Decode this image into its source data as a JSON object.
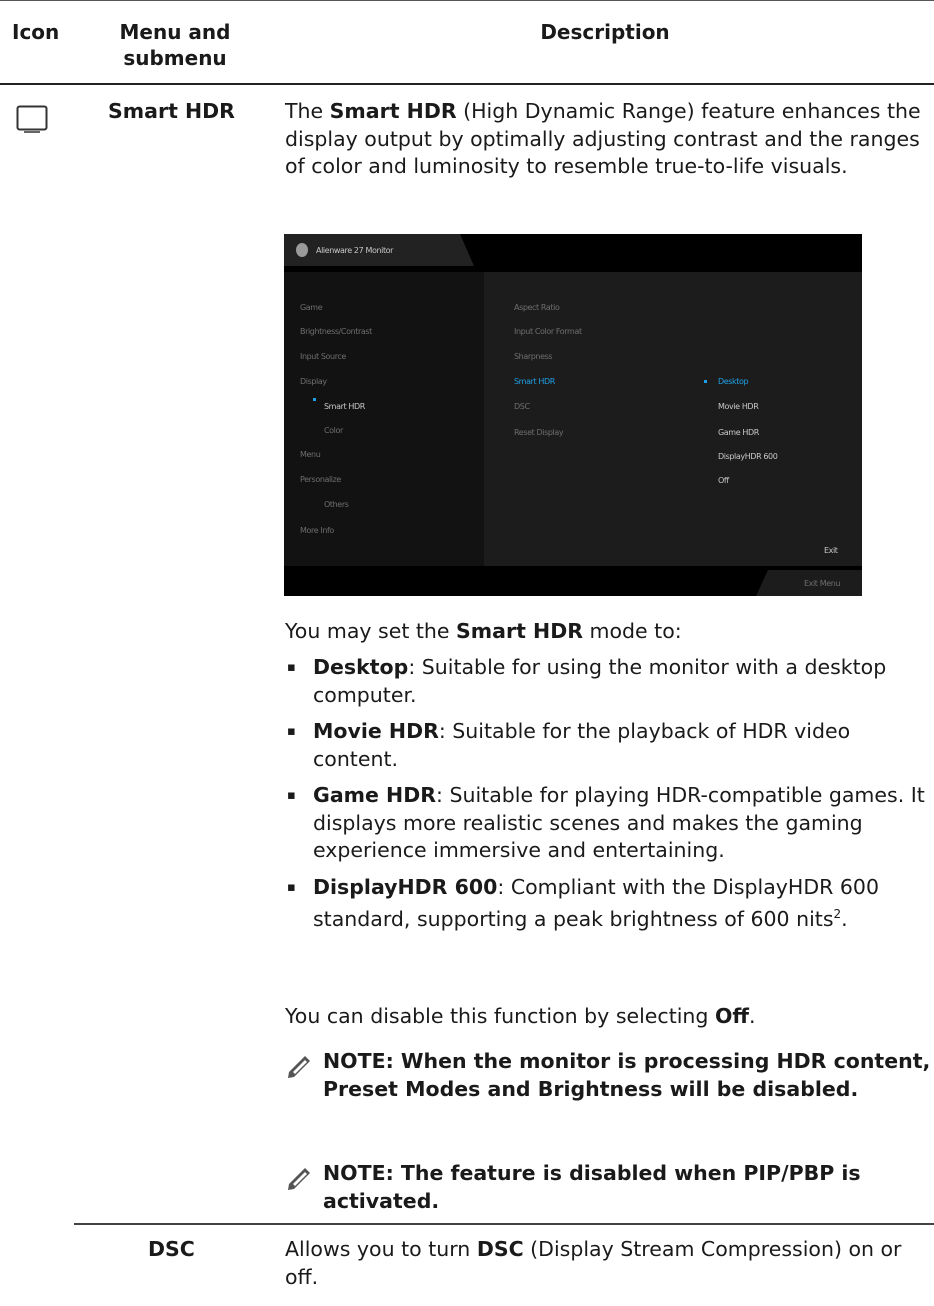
{
  "table_header": {
    "icon": "Icon",
    "menu": "Menu and submenu",
    "description": "Description"
  },
  "rows": [
    {
      "icon_name": "monitor-icon",
      "menu": "Smart HDR",
      "intro": {
        "pre": "The ",
        "bold": "Smart HDR",
        "post": " (High Dynamic Range) feature enhances the display output by optimally adjusting contrast and the ranges of color and luminosity to resemble true-to-life visuals."
      },
      "osd_screenshot": {
        "header_title": "Alienware 27 Monitor",
        "nav_items": [
          "Game",
          "Brightness/Contrast",
          "Input Source",
          "Display",
          "Smart HDR",
          "Color",
          "Menu",
          "Personalize",
          "Others",
          "More Info"
        ],
        "options": [
          "Aspect Ratio",
          "Input Color Format",
          "Sharpness",
          "Smart HDR",
          "DSC",
          "Reset Display"
        ],
        "values": [
          "Desktop",
          "Movie HDR",
          "Game HDR",
          "DisplayHDR 600",
          "Off"
        ],
        "footer": "Exit",
        "exit_label": "Exit Menu"
      },
      "modes_intro": {
        "pre": "You may set the ",
        "bold": "Smart HDR",
        "post": " mode to:"
      },
      "modes": [
        {
          "name": "Desktop",
          "text": ": Suitable for using the monitor with a desktop computer."
        },
        {
          "name": "Movie HDR",
          "text": ": Suitable for the playback of HDR video content."
        },
        {
          "name": "Game HDR",
          "text": ": Suitable for playing HDR-compatible games. It displays more realistic scenes and makes the gaming experience immersive and entertaining."
        },
        {
          "name": "DisplayHDR 600",
          "text": ": Compliant with the DisplayHDR 600 standard, supporting a peak brightness of 600 nits",
          "sup": "2",
          "end": "."
        }
      ],
      "disable": {
        "pre": "You can disable this function by selecting ",
        "bold": "Off",
        "post": "."
      },
      "notes": [
        "NOTE: When the monitor is processing HDR content, Preset Modes and Brightness will be disabled.",
        "NOTE: The feature is disabled when PIP/PBP is activated."
      ]
    },
    {
      "menu": "DSC",
      "desc": {
        "pre": "Allows you to turn ",
        "bold": "DSC",
        "post": " (Display Stream Compression) on or off."
      }
    }
  ]
}
